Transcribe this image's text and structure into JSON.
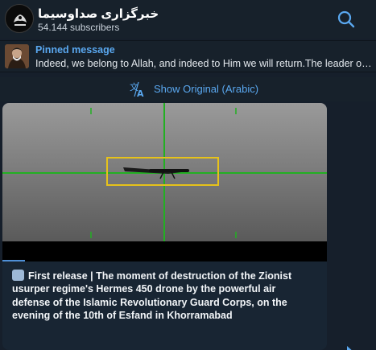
{
  "header": {
    "channel_title": "خبرگزاری صداوسیما",
    "subscribers": "54.144 subscribers"
  },
  "pinned": {
    "title": "Pinned message",
    "text": "Indeed, we belong to Allah, and indeed to Him we will return.The leader of the Islamic Revolution"
  },
  "translate": {
    "label": "Show Original (Arabic)"
  },
  "message": {
    "caption": "First release | The moment of destruction of the Zionist usurper regime's Hermes 450 drone by the powerful air defense of the Islamic Revolutionary Guard Corps, on the evening of the 10th of Esfand in Khorramabad",
    "video_progress": 0.07
  },
  "colors": {
    "accent": "#5aa8f0",
    "crosshair": "#22b022",
    "target_box": "#e6c21a"
  }
}
